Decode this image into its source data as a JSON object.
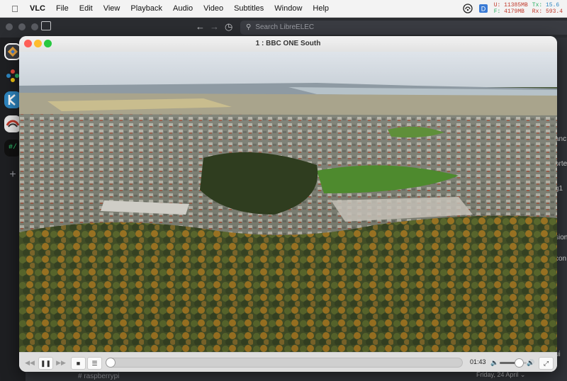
{
  "menubar": {
    "app_name": "VLC",
    "items": [
      "File",
      "Edit",
      "View",
      "Playback",
      "Audio",
      "Video",
      "Subtitles",
      "Window",
      "Help"
    ],
    "net": {
      "u_label": "U:",
      "u_value": "11385MB",
      "f_label": "F:",
      "f_value": "4179MB",
      "tx_label": "Tx:",
      "tx_value": "15.6",
      "rx_label": "Rx:",
      "rx_value": "593.4"
    }
  },
  "background_app": {
    "search_placeholder": "Search LibreELEC",
    "channel": "raspberrypi",
    "date_separator": "Friday, 24 April",
    "right_fragments": [
      "anc",
      "orte",
      "g1",
      "sion",
      "con",
      "ui"
    ]
  },
  "vlc": {
    "window_title": "1 : BBC ONE South",
    "time": "01:43",
    "playback_progress": 0.0,
    "volume_level": 0.7
  },
  "icons": {
    "apple": "apple-logo-icon",
    "rewind": "rewind-icon",
    "pause": "pause-icon",
    "forward": "fast-forward-icon",
    "stop": "stop-icon",
    "playlist": "playlist-icon",
    "vol_low": "volume-low-icon",
    "vol_high": "volume-high-icon",
    "fullscreen": "fullscreen-icon"
  },
  "colors": {
    "close": "#fe5f57",
    "minimize": "#febc2e",
    "zoom": "#28c840"
  }
}
